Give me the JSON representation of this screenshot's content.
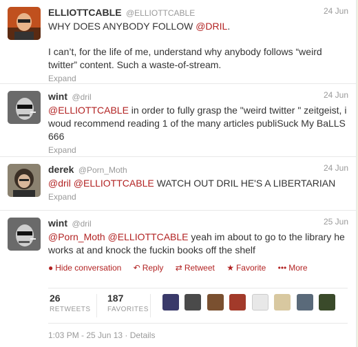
{
  "tweets": [
    {
      "fullname": "ELLIOTTCABLE",
      "username": "@ELLIOTTCABLE",
      "time": "24 Jun",
      "line1_a": "WHY DOES ANYBODY FOLLOW ",
      "line1_mention": "@DRIL",
      "line1_b": ".",
      "para2": "I can’t, for the life of me, understand why anybody follows “weird twitter” content. Such a waste-of-stream.",
      "expand": "Expand"
    },
    {
      "fullname": "wint",
      "username": "@dril",
      "time": "24 Jun",
      "mention": "@ELLIOTTCABLE",
      "text": " in order to fully grasp the \"weird twitter \" zeitgeist, i woud recommend reading 1 of the many articles publiSuck My BaLLS 666",
      "expand": "Expand"
    },
    {
      "fullname": "derek",
      "username": "@Porn_Moth",
      "time": "24 Jun",
      "mention1": "@dril",
      "mention2": "@ELLIOTTCABLE",
      "text": " WATCH OUT DRIL HE'S A LIBERTARIAN",
      "expand": "Expand"
    },
    {
      "fullname": "wint",
      "username": "@dril",
      "time": "25 Jun",
      "mention1": "@Porn_Moth",
      "mention2": "@ELLIOTTCABLE",
      "text": " yeah im about to go to the library he works at and knock the fuckin books off the shelf"
    }
  ],
  "actions": {
    "hide": "Hide conversation",
    "reply": "Reply",
    "retweet": "Retweet",
    "favorite": "Favorite",
    "more": "More"
  },
  "stats": {
    "retweets_count": "26",
    "retweets_label": "RETWEETS",
    "favorites_count": "187",
    "favorites_label": "FAVORITES"
  },
  "footer": {
    "timestamp": "1:03 PM - 25 Jun 13",
    "separator": "·",
    "details": "Details"
  },
  "colors": {
    "accent": "#b22222",
    "muted": "#999999",
    "page_bg": "#f2f2df"
  }
}
